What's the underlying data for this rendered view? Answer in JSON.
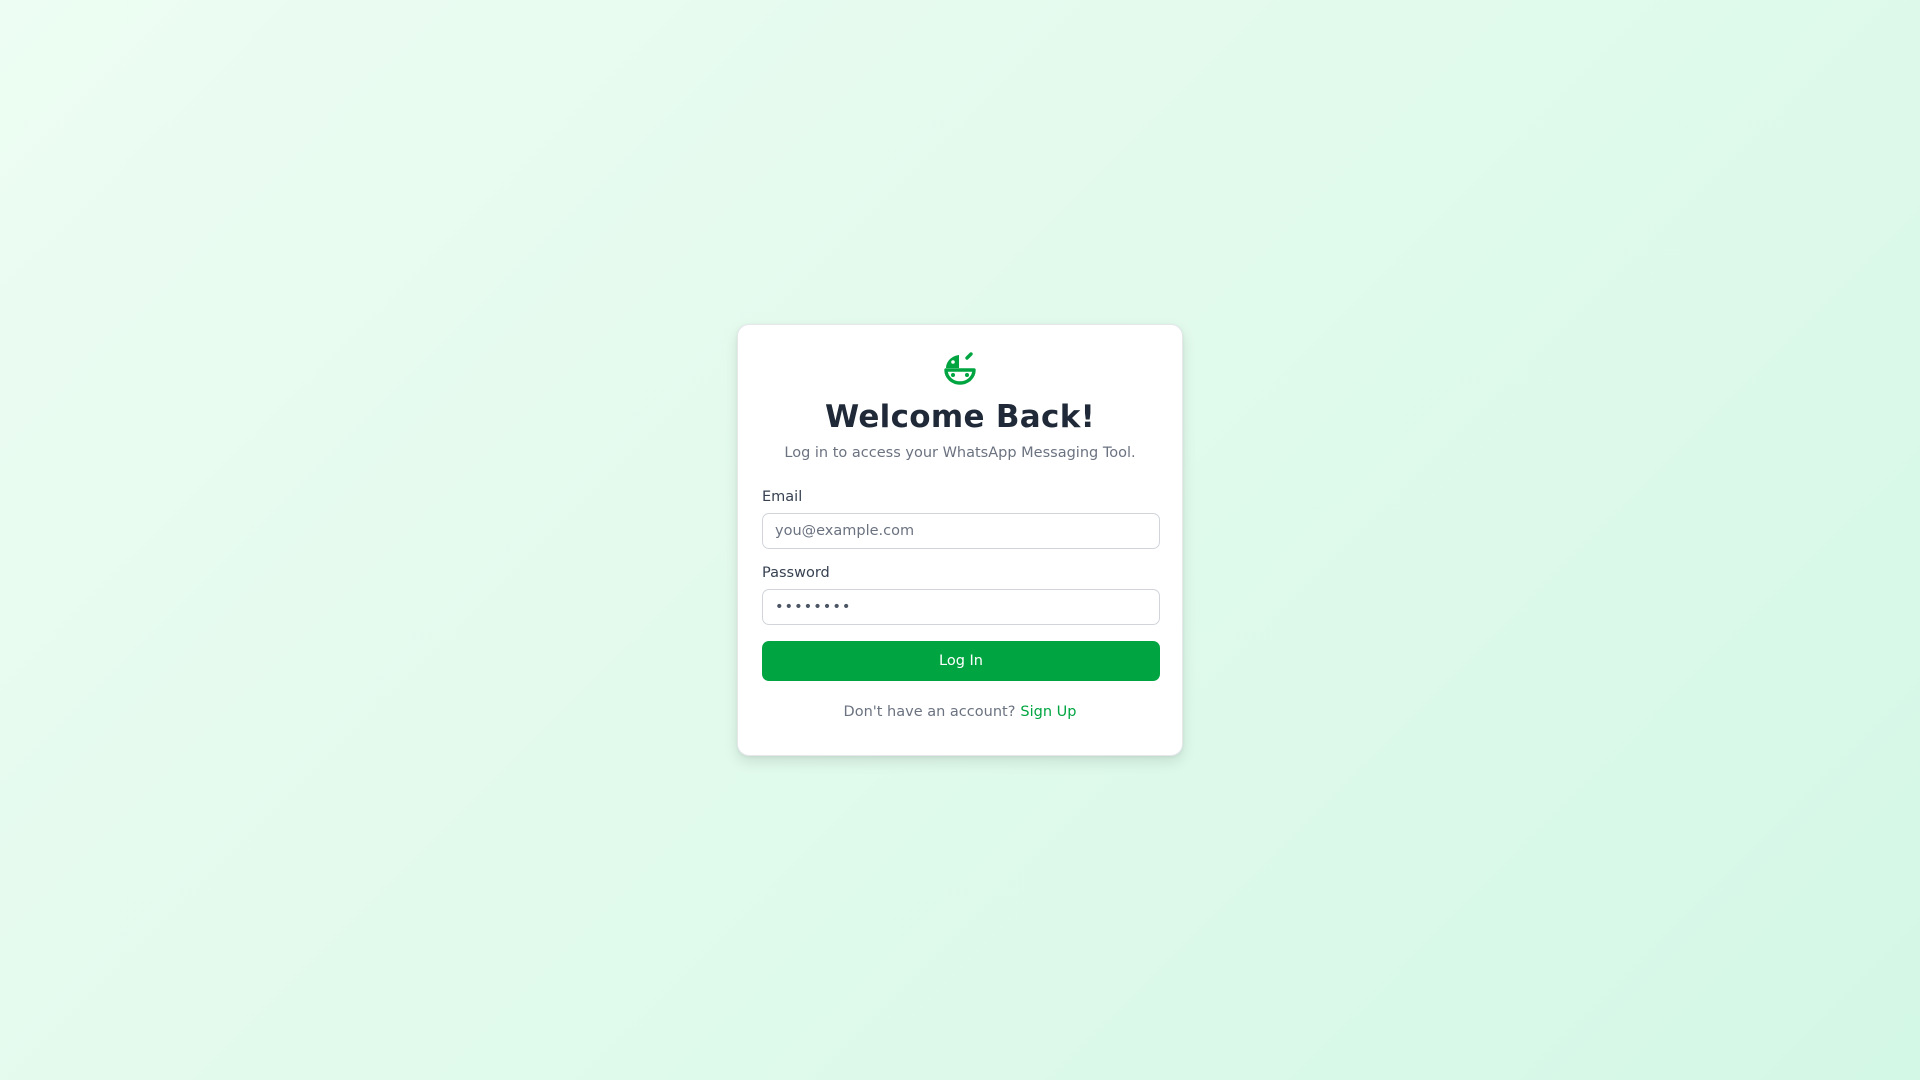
{
  "colors": {
    "accent": "#00a541",
    "background": "#e2faec",
    "title": "#1f2937",
    "muted": "#6b7280"
  },
  "logo": {
    "icon": "leaf-chat-icon"
  },
  "login": {
    "title": "Welcome Back!",
    "subtitle": "Log in to access your WhatsApp Messaging Tool.",
    "email_label": "Email",
    "email_placeholder": "you@example.com",
    "email_value": "",
    "password_label": "Password",
    "password_value": "password",
    "submit_label": "Log In",
    "signup_prompt": "Don't have an account?",
    "signup_link": "Sign Up"
  }
}
